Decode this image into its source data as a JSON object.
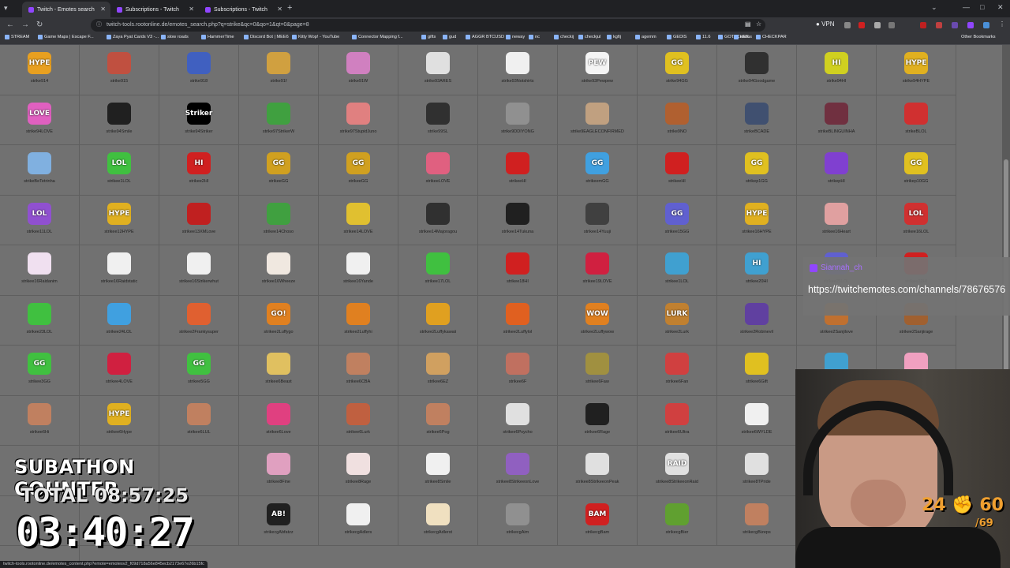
{
  "tabs": [
    {
      "label": "Twitch - Emotes search",
      "active": true
    },
    {
      "label": "Subscriptions - Twitch",
      "active": false
    },
    {
      "label": "Subscriptions - Twitch",
      "active": false
    }
  ],
  "address": {
    "url": "twitch-tools.rootonline.de/emotes_search.php?q=strike&qc=0&qo=1&qt=0&page=8"
  },
  "toolbar": {
    "vpn_label": "VPN"
  },
  "bookmarks": [
    "STREAM",
    "Game Maps | Escape F...",
    "Zaya Pyat Cards V3 -...",
    "slow roads",
    "HammerTime",
    "Discord Bot | MEE6",
    "Kitty Wop! - YouTube",
    "Connector Mapping f...",
    "gifts",
    "gud",
    "AGGR BTCUSD",
    "neway",
    "nc",
    "checkij",
    "checkjul",
    "kgfij",
    "agemm",
    "GEDIS",
    "11.6",
    "GOTACHEK",
    "asdas",
    "CHECKPAR"
  ],
  "bookmarks_other": "Other Bookmarks",
  "emotes": [
    {
      "name": "strike914",
      "text": "HYPE",
      "color": "#e8a020"
    },
    {
      "name": "strike915",
      "text": "",
      "color": "#c05040"
    },
    {
      "name": "strike918",
      "text": "",
      "color": "#4060c0"
    },
    {
      "name": "strike91f",
      "text": "",
      "color": "#d0a040"
    },
    {
      "name": "strike91W",
      "text": "",
      "color": "#d080c0"
    },
    {
      "name": "strike93ARES",
      "text": "",
      "color": "#e0e0e0"
    },
    {
      "name": "strike93Notshirts",
      "text": "",
      "color": "#f0f0f0"
    },
    {
      "name": "strike93Pewpew",
      "text": "PEW",
      "color": "#f4f4f4"
    },
    {
      "name": "strike94GG",
      "text": "GG",
      "color": "#e0c020"
    },
    {
      "name": "strike94Goodgame",
      "text": "",
      "color": "#303030"
    },
    {
      "name": "strike94HI",
      "text": "HI",
      "color": "#d0d020"
    },
    {
      "name": "strike94HYPE",
      "text": "HYPE",
      "color": "#e0b020"
    },
    {
      "name": "strike94LOVE",
      "text": "LOVE",
      "color": "#e060c0"
    },
    {
      "name": "strike94Smile",
      "text": "",
      "color": "#202020"
    },
    {
      "name": "strike94Striker",
      "text": "Striker",
      "color": "#000000"
    },
    {
      "name": "strike97StrikerW",
      "text": "",
      "color": "#40a040"
    },
    {
      "name": "strike97StupidJuno",
      "text": "",
      "color": "#e08080"
    },
    {
      "name": "strike99SL",
      "text": "",
      "color": "#303030"
    },
    {
      "name": "strike9DDIYONG",
      "text": "",
      "color": "#909090"
    },
    {
      "name": "strike9EAGLECONFIRMED",
      "text": "",
      "color": "#c0a080"
    },
    {
      "name": "strike9NO",
      "text": "",
      "color": "#b06030"
    },
    {
      "name": "strikeBCADE",
      "text": "",
      "color": "#405070"
    },
    {
      "name": "strikeBLINGUINHA",
      "text": "",
      "color": "#703040"
    },
    {
      "name": "strikeBLOL",
      "text": "",
      "color": "#d03030"
    },
    {
      "name": "strikeBeTetrinha",
      "text": "",
      "color": "#80b0e0"
    },
    {
      "name": "strikee1LOL",
      "text": "LOL",
      "color": "#40c040"
    },
    {
      "name": "strikee2HI",
      "text": "HI",
      "color": "#d02020"
    },
    {
      "name": "strikeeGG",
      "text": "GG",
      "color": "#d0a020"
    },
    {
      "name": "strikeeGG",
      "text": "GG",
      "color": "#d0a020"
    },
    {
      "name": "strikeeLOVE",
      "text": "",
      "color": "#e06080"
    },
    {
      "name": "strikeeHI",
      "text": "",
      "color": "#d02020"
    },
    {
      "name": "strikeemGG",
      "text": "GG",
      "color": "#40a0e0"
    },
    {
      "name": "strikeeHI",
      "text": "",
      "color": "#d02020"
    },
    {
      "name": "strikep1GG",
      "text": "GG",
      "color": "#e0c020"
    },
    {
      "name": "strikepHI",
      "text": "",
      "color": "#8040d0"
    },
    {
      "name": "strikep10GG",
      "text": "GG",
      "color": "#e0c020"
    },
    {
      "name": "strikee11LOL",
      "text": "LOL",
      "color": "#9050d0"
    },
    {
      "name": "strikee12HYPE",
      "text": "HYPE",
      "color": "#e0b020"
    },
    {
      "name": "strikee13XMLove",
      "text": "",
      "color": "#c02020"
    },
    {
      "name": "strikee14Choso",
      "text": "",
      "color": "#40a040"
    },
    {
      "name": "strikee14LOVE",
      "text": "",
      "color": "#e0c030"
    },
    {
      "name": "strikee14Majoragou",
      "text": "",
      "color": "#303030"
    },
    {
      "name": "strikee14Tukuna",
      "text": "",
      "color": "#202020"
    },
    {
      "name": "strikee14Yuuji",
      "text": "",
      "color": "#404040"
    },
    {
      "name": "strikee15GG",
      "text": "GG",
      "color": "#6060d0"
    },
    {
      "name": "strikee16HYPE",
      "text": "HYPE",
      "color": "#e0b020"
    },
    {
      "name": "strikee16Heart",
      "text": "",
      "color": "#e0a0a0"
    },
    {
      "name": "strikee16LOL",
      "text": "LOL",
      "color": "#d03030"
    },
    {
      "name": "strikee16Raidanim",
      "text": "",
      "color": "#f0e0f0"
    },
    {
      "name": "strikee16Raidstatic",
      "text": "",
      "color": "#f0f0f0"
    },
    {
      "name": "strikee16Strikerwhut",
      "text": "",
      "color": "#f0f0f0"
    },
    {
      "name": "strikee16Wheeze",
      "text": "",
      "color": "#f0e8e0"
    },
    {
      "name": "strikee16Yande",
      "text": "",
      "color": "#f0f0f0"
    },
    {
      "name": "strikee17LOL",
      "text": "",
      "color": "#40c040"
    },
    {
      "name": "strikee18HI",
      "text": "",
      "color": "#d02020"
    },
    {
      "name": "strikee19LOVE",
      "text": "",
      "color": "#d02040"
    },
    {
      "name": "strikee1LOL",
      "text": "",
      "color": "#40a0d0"
    },
    {
      "name": "strikee20HI",
      "text": "HI",
      "color": "#40a0d0"
    },
    {
      "name": "strikee21LOL",
      "text": "",
      "color": "#6060d0"
    },
    {
      "name": "strikee22HI",
      "text": "",
      "color": "#d02020"
    },
    {
      "name": "strikee23LOL",
      "text": "",
      "color": "#40c040"
    },
    {
      "name": "strikee24LOL",
      "text": "",
      "color": "#40a0e0"
    },
    {
      "name": "strikee2Frankysuper",
      "text": "",
      "color": "#e06030"
    },
    {
      "name": "strikee2Luffygo",
      "text": "GO!",
      "color": "#e08020"
    },
    {
      "name": "strikee2Luffyhi",
      "text": "",
      "color": "#e08020"
    },
    {
      "name": "strikee2Luffykawaii",
      "text": "",
      "color": "#e0a020"
    },
    {
      "name": "strikee2Luffylol",
      "text": "",
      "color": "#e06020"
    },
    {
      "name": "strikee2Luffywow",
      "text": "WOW",
      "color": "#e08020"
    },
    {
      "name": "strikee2Lurk",
      "text": "LURK",
      "color": "#c08030"
    },
    {
      "name": "strikee2Robinevil",
      "text": "",
      "color": "#6040a0"
    },
    {
      "name": "strikee2Sanjilove",
      "text": "",
      "color": "#c07030"
    },
    {
      "name": "strikee2Sanjirage",
      "text": "",
      "color": "#a06030"
    },
    {
      "name": "strikee3GG",
      "text": "GG",
      "color": "#40c040"
    },
    {
      "name": "strikee4LOVE",
      "text": "",
      "color": "#d02040"
    },
    {
      "name": "strikee5GG",
      "text": "GG",
      "color": "#40c040"
    },
    {
      "name": "strikee6Beast",
      "text": "",
      "color": "#e0c060"
    },
    {
      "name": "strikee6CBA",
      "text": "",
      "color": "#c08060"
    },
    {
      "name": "strikee6EZ",
      "text": "",
      "color": "#d0a060"
    },
    {
      "name": "strikee6F",
      "text": "",
      "color": "#c07060"
    },
    {
      "name": "strikee6Faw",
      "text": "",
      "color": "#a09040"
    },
    {
      "name": "strikee6Fan",
      "text": "",
      "color": "#d04040"
    },
    {
      "name": "strikee6Gift",
      "text": "",
      "color": "#e0c020"
    },
    {
      "name": "strikee6Hi",
      "text": "",
      "color": "#40a0d0"
    },
    {
      "name": "strikee6Hehe",
      "text": "",
      "color": "#f0a0c0"
    },
    {
      "name": "strikee6Hi",
      "text": "",
      "color": "#c08060"
    },
    {
      "name": "strikee6Hype",
      "text": "HYPE",
      "color": "#e0b020"
    },
    {
      "name": "strikee6LUL",
      "text": "",
      "color": "#c08060"
    },
    {
      "name": "strikee6Love",
      "text": "",
      "color": "#e04080"
    },
    {
      "name": "strikee6Lurk",
      "text": "",
      "color": "#c06040"
    },
    {
      "name": "strikee6Pog",
      "text": "",
      "color": "#c08060"
    },
    {
      "name": "strikee6Psycho",
      "text": "",
      "color": "#e0e0e0"
    },
    {
      "name": "strikee6Rage",
      "text": "",
      "color": "#202020"
    },
    {
      "name": "strikee6Ultra",
      "text": "",
      "color": "#d04040"
    },
    {
      "name": "strikee6WYLDE",
      "text": "",
      "color": "#f0f0f0"
    },
    {
      "name": "",
      "text": "",
      "color": "#717171"
    },
    {
      "name": "",
      "text": "",
      "color": "#717171"
    },
    {
      "name": "",
      "text": "",
      "color": "#717171"
    },
    {
      "name": "",
      "text": "",
      "color": "#717171"
    },
    {
      "name": "",
      "text": "",
      "color": "#717171"
    },
    {
      "name": "strikee8Fine",
      "text": "",
      "color": "#e0a0c0"
    },
    {
      "name": "strikee8Rage",
      "text": "",
      "color": "#f0e0e0"
    },
    {
      "name": "strikee8Smile",
      "text": "",
      "color": "#f0f0f0"
    },
    {
      "name": "strikee8StrikeeonLove",
      "text": "",
      "color": "#9060c0"
    },
    {
      "name": "strikee8StrikeeonPeak",
      "text": "",
      "color": "#e0e0e0"
    },
    {
      "name": "strikee8StrikeeonRaid",
      "text": "RAID",
      "color": "#e0e0e0"
    },
    {
      "name": "strikee8TPride",
      "text": "",
      "color": "#e0e0e0"
    },
    {
      "name": "",
      "text": "",
      "color": "#717171"
    },
    {
      "name": "",
      "text": "",
      "color": "#717171"
    },
    {
      "name": "",
      "text": "",
      "color": "#717171"
    },
    {
      "name": "",
      "text": "",
      "color": "#717171"
    },
    {
      "name": "",
      "text": "",
      "color": "#717171"
    },
    {
      "name": "strikecgAbfatzz",
      "text": "AB!",
      "color": "#202020"
    },
    {
      "name": "strikecgAdlers",
      "text": "",
      "color": "#f0f0f0"
    },
    {
      "name": "strikecgAdlerst",
      "text": "",
      "color": "#f0e0c0"
    },
    {
      "name": "strikecgAim",
      "text": "",
      "color": "#909090"
    },
    {
      "name": "strikecgBam",
      "text": "BAM",
      "color": "#d02020"
    },
    {
      "name": "strikecgBier",
      "text": "",
      "color": "#60a030"
    },
    {
      "name": "strikecgBizeps",
      "text": "",
      "color": "#c08060"
    },
    {
      "name": "",
      "text": "",
      "color": "#717171"
    },
    {
      "name": "",
      "text": "",
      "color": "#717171"
    },
    {
      "name": "",
      "text": "",
      "color": "#717171"
    }
  ],
  "overlay": {
    "username": "Siannah_ch",
    "link": "https://twitchemotes.com/channels/78676576"
  },
  "counter": {
    "title": "SUBATHON COUNTER",
    "total": "TOTAL 08:57:25",
    "timer": "03:40:27"
  },
  "webcam": {
    "stat_main": "24 ✊ 60",
    "stat_sub": "/69"
  },
  "status_url": "twitch-tools.rootonline.de/emotes_content.php?emote=emotesv2_f09d718a56e845ecb2173e67e26b15fc"
}
